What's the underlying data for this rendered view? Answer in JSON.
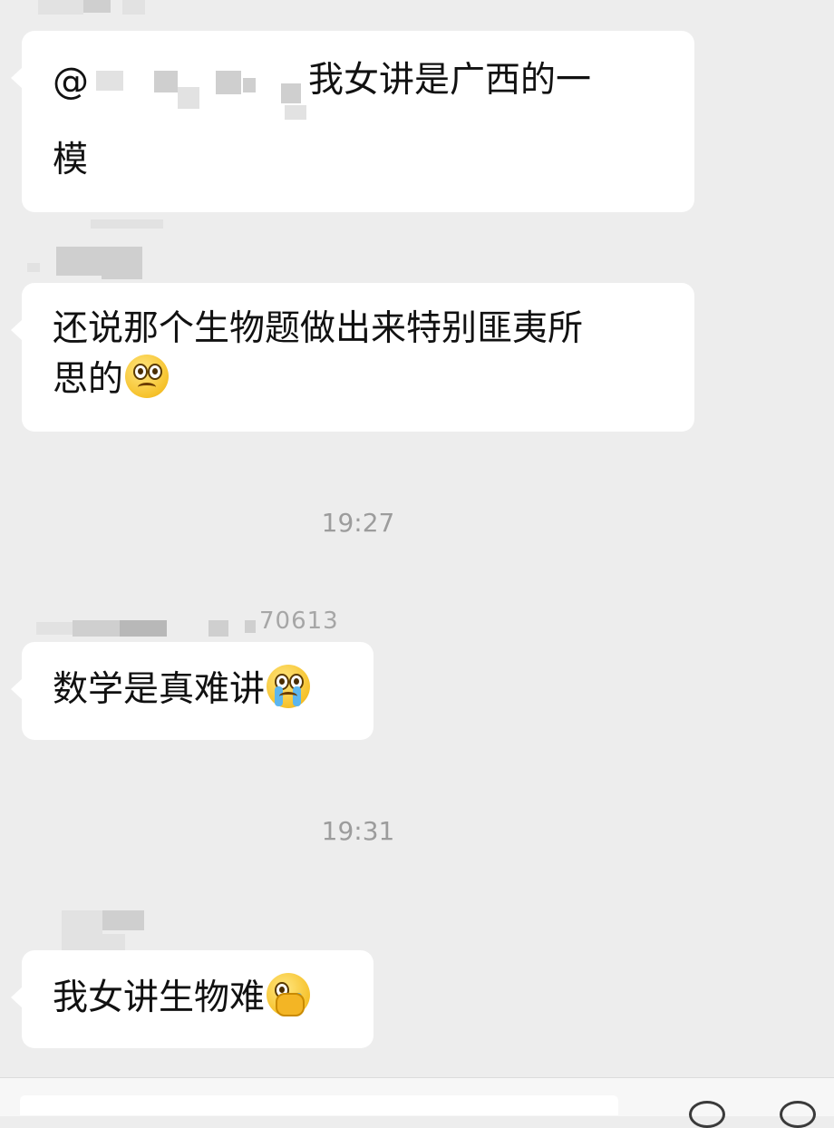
{
  "messages": [
    {
      "sender": "",
      "mention_prefix": "@",
      "text_line1": "我女讲是广西的一",
      "text_line2": "模"
    },
    {
      "sender": "",
      "text_line1": "还说那个生物题做出来特别匪夷所",
      "text_line2": "思的",
      "emoji": "woozy-pleading-face-icon"
    },
    {
      "sender_visible_fragment": "70613",
      "text_line1": "数学是真难讲",
      "emoji": "crying-face-icon"
    },
    {
      "sender": "",
      "text_line1": "我女讲生物难",
      "emoji": "face-palm-icon"
    }
  ],
  "timestamps": [
    "19:27",
    "19:31"
  ],
  "colors": {
    "background": "#ededed",
    "bubble": "#ffffff",
    "text": "#111111",
    "timestamp": "#9c9c9c"
  }
}
